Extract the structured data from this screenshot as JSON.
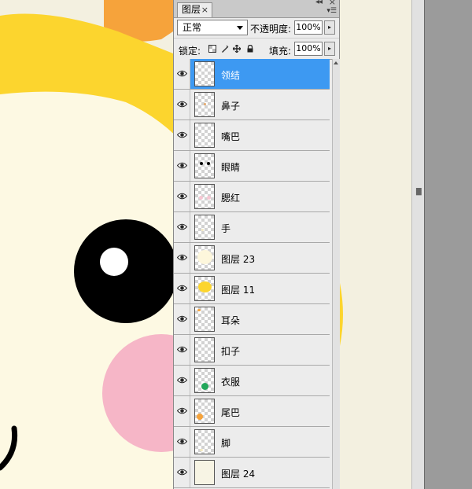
{
  "panel": {
    "tab_label": "图层",
    "tab_close": "×",
    "collapse": "◂◂",
    "close": "×",
    "menu": "▾☰"
  },
  "blend": {
    "mode": "正常"
  },
  "opacity": {
    "label": "不透明度:",
    "value": "100%"
  },
  "lock": {
    "label": "锁定:"
  },
  "fill": {
    "label": "填充:",
    "value": "100%"
  },
  "spin_arrow": "▸",
  "layers": [
    {
      "name": "领结",
      "selected": true
    },
    {
      "name": "鼻子"
    },
    {
      "name": "嘴巴"
    },
    {
      "name": "眼睛"
    },
    {
      "name": "腮红"
    },
    {
      "name": "手"
    },
    {
      "name": "图层 23"
    },
    {
      "name": "图层 11"
    },
    {
      "name": "耳朵"
    },
    {
      "name": "扣子"
    },
    {
      "name": "衣服"
    },
    {
      "name": "尾巴"
    },
    {
      "name": "脚"
    },
    {
      "name": "图层 24"
    }
  ],
  "colors": {
    "selected": "#3d99f2",
    "canvas_bg": "#f3f0e0",
    "face": "#fdf9e3",
    "hair": "#fcd52e",
    "ear": "#f6a33b",
    "blush": "#f6b6c7",
    "eye": "#000000"
  }
}
